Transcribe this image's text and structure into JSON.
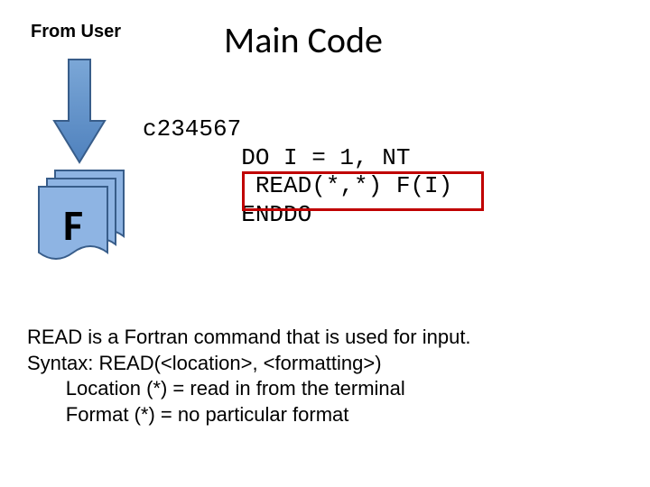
{
  "from_user_label": "From User",
  "title": "Main Code",
  "code": {
    "line1": "c234567",
    "line2": "       DO I = 1, NT",
    "line3": "        READ(*,*) F(I)",
    "line4": "       ENDDO"
  },
  "doc_letter": "F",
  "explain": {
    "l1": "READ is a Fortran command that is used for input.",
    "l2": "Syntax: READ(<location>, <formatting>)",
    "l3": "       Location (*) = read in from the terminal",
    "l4": "       Format (*) = no particular format"
  },
  "icons": {
    "arrow": "down-arrow-icon",
    "doc": "document-icon"
  },
  "colors": {
    "arrow_fill": "#558ed5",
    "doc_fill": "#8eb4e3",
    "doc_stroke": "#385d8a",
    "highlight": "#c00000"
  }
}
